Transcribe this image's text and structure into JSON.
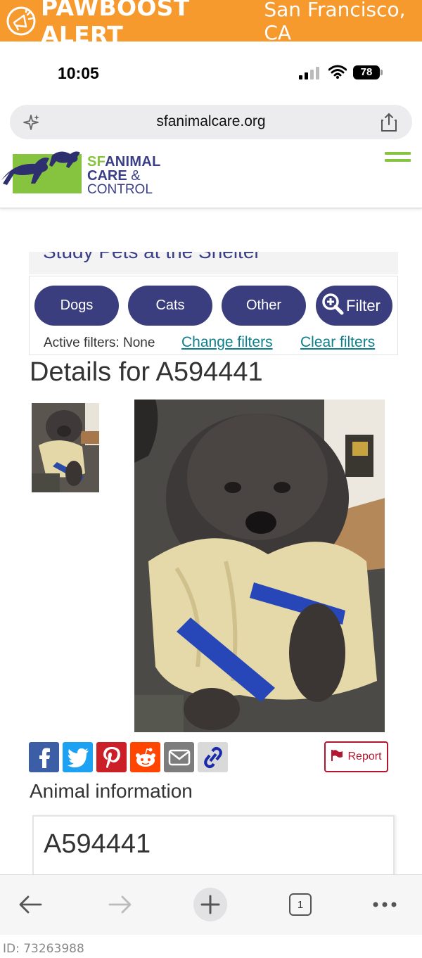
{
  "alert": {
    "brand": "PAWBOOST ALERT",
    "location": "San Francisco, CA",
    "color": "#f79a2e"
  },
  "status_bar": {
    "time": "10:05",
    "battery": "78"
  },
  "browser": {
    "url": "sfanimalcare.org"
  },
  "site": {
    "logo_line1_sf": "SF",
    "logo_line1_rest": "ANIMAL",
    "logo_line2": "CARE",
    "logo_line2_amp": "&",
    "logo_line3": "CONTROL",
    "accent_green": "#86c33f",
    "accent_navy": "#3a3e7e"
  },
  "page": {
    "peek_heading": "Study Pets at the Shelter",
    "filters": {
      "dogs": "Dogs",
      "cats": "Cats",
      "other": "Other",
      "filter": "Filter",
      "active_label": "Active filters: None",
      "change": "Change filters",
      "clear": "Clear filters"
    },
    "details_title": "Details for A594441",
    "report_label": "Report",
    "animal_info_title": "Animal information",
    "animal_id": "A594441"
  },
  "share_icons": [
    "facebook-icon",
    "twitter-icon",
    "pinterest-icon",
    "reddit-icon",
    "email-icon",
    "link-icon"
  ],
  "toolbar": {
    "tab_count": "1"
  },
  "footer": {
    "id_text": "ID: 73263988"
  }
}
